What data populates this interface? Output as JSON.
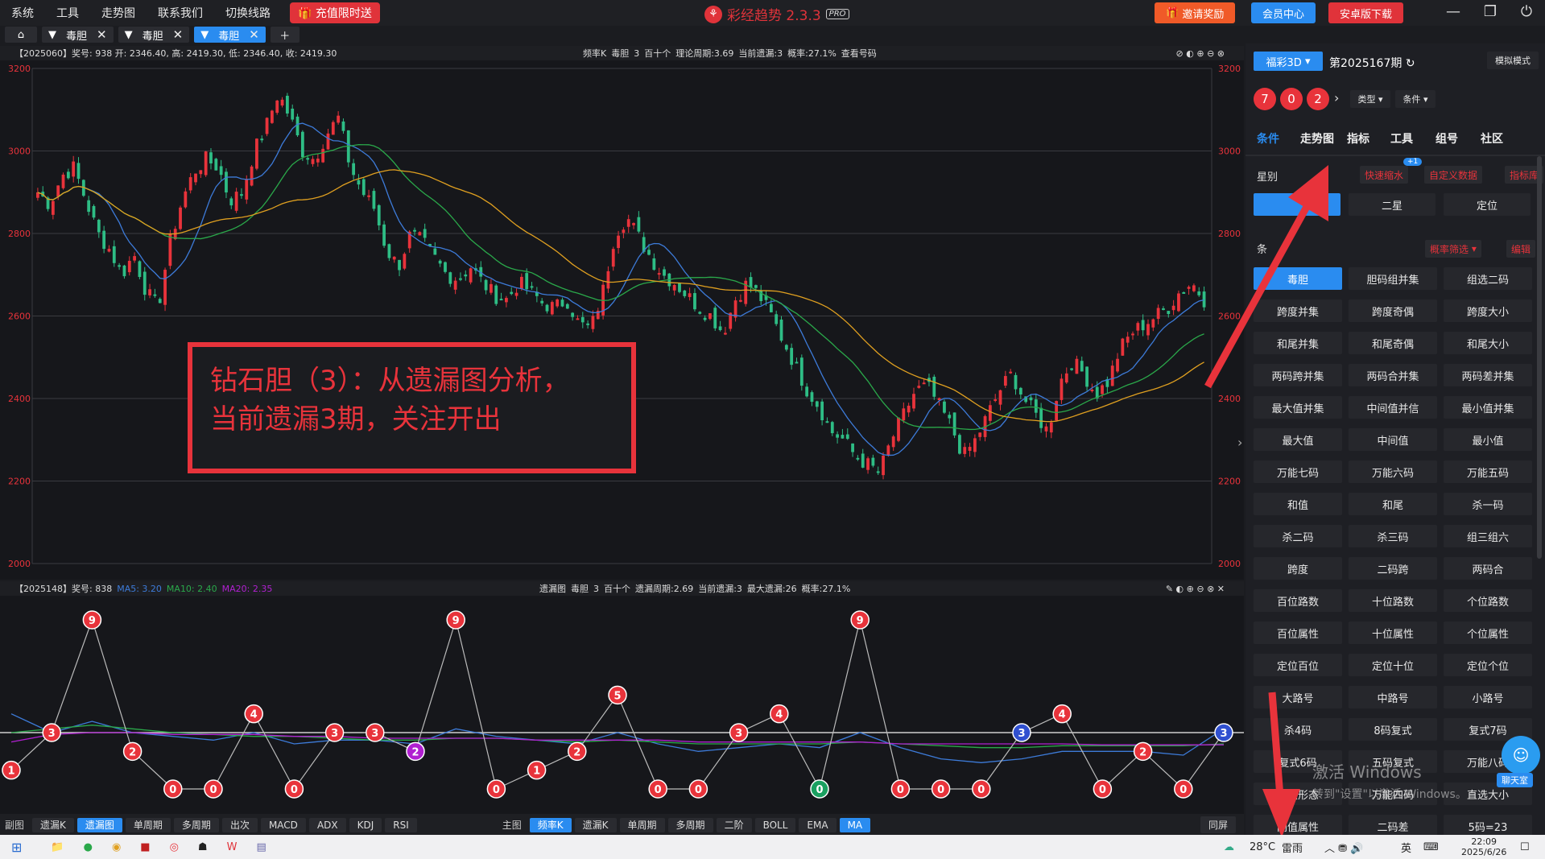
{
  "menu": [
    "系统",
    "工具",
    "走势图",
    "联系我们",
    "切换线路"
  ],
  "promo": "充值限时送",
  "app_title": "彩经趋势 2.3.3",
  "app_badge": "PRO",
  "top_buttons": {
    "invite": "邀请奖励",
    "member": "会员中心",
    "android": "安卓版下载"
  },
  "tabs": [
    "毒胆",
    "毒胆",
    "毒胆"
  ],
  "top_info": {
    "left": "【2025060】奖号: 938  开: 2346.40, 高: 2419.30, 低: 2346.40, 收: 2419.30",
    "right": [
      "频率K",
      "毒胆",
      "3",
      "百十个",
      "理论周期:3.69",
      "当前遗漏:3",
      "概率:27.1%",
      "查看号码"
    ]
  },
  "bottom_info": {
    "period": "【2025148】奖号: 838",
    "ma5": "MA5: 3.20",
    "ma10": "MA10: 2.40",
    "ma20": "MA20: 2.35",
    "right": [
      "遗漏图",
      "毒胆",
      "3",
      "百十个",
      "遗漏周期:2.69",
      "当前遗漏:3",
      "最大遗漏:26",
      "概率:27.1%"
    ]
  },
  "y_labels": [
    "3200",
    "3000",
    "2800",
    "2600",
    "2400",
    "2200",
    "2000"
  ],
  "colors": {
    "up": "#e8333b",
    "down": "#2ebd85",
    "ma5": "#3d7bd9",
    "ma10": "#2aa84a",
    "ma20": "#e0a020",
    "accent": "#2a8cf0",
    "red": "#e8333b",
    "purple": "#b020d0",
    "blue": "#3050d0",
    "green": "#1aa060"
  },
  "chart_data": [
    {
      "type": "candlestick",
      "title": "",
      "description": "频率K candlestick",
      "ylim": [
        2000,
        3200
      ],
      "close_trend": [
        2900,
        2870,
        2940,
        2960,
        2880,
        2800,
        2760,
        2700,
        2750,
        2660,
        2620,
        2780,
        2880,
        2950,
        2980,
        2960,
        2880,
        2900,
        3000,
        3060,
        3140,
        3080,
        3000,
        2980,
        3040,
        3080,
        2960,
        2900,
        2860,
        2760,
        2720,
        2800,
        2780,
        2740,
        2700,
        2690,
        2720,
        2680,
        2650,
        2640,
        2680,
        2660,
        2630,
        2620,
        2640,
        2580,
        2570,
        2660,
        2800,
        2840,
        2790,
        2740,
        2700,
        2680,
        2650,
        2620,
        2600,
        2560,
        2640,
        2680,
        2650,
        2600,
        2540,
        2480,
        2420,
        2380,
        2320,
        2300,
        2260,
        2240,
        2220,
        2300,
        2360,
        2420,
        2430,
        2380,
        2330,
        2260,
        2300,
        2360,
        2420,
        2460,
        2400,
        2360,
        2320,
        2440,
        2490,
        2460,
        2410,
        2440,
        2520,
        2560,
        2580,
        2600,
        2620,
        2660,
        2680,
        2640
      ]
    },
    {
      "type": "line",
      "title": "",
      "description": "遗漏图 omission values",
      "values": [
        1,
        3,
        9,
        2,
        0,
        0,
        4,
        0,
        3,
        3,
        2,
        9,
        0,
        1,
        2,
        5,
        0,
        0,
        3,
        4,
        0,
        9,
        0,
        0,
        0,
        3,
        4,
        0,
        2,
        0,
        3
      ],
      "ma5": [
        4,
        3,
        3.6,
        3,
        2.8,
        2.6,
        3,
        2.4,
        2.6,
        2.6,
        2.4,
        3.2,
        2.8,
        2.6,
        2.4,
        3,
        2.4,
        2,
        2.2,
        2.4,
        2.2,
        3,
        2.2,
        1.6,
        1.4,
        1.6,
        2,
        2,
        2,
        1.8,
        3.2
      ],
      "ma10": [
        3,
        3.2,
        3.4,
        3.2,
        3,
        2.9,
        2.8,
        2.8,
        2.7,
        2.6,
        2.6,
        2.7,
        2.7,
        2.6,
        2.5,
        2.6,
        2.5,
        2.4,
        2.4,
        2.4,
        2.4,
        2.5,
        2.4,
        2.3,
        2.2,
        2.2,
        2.3,
        2.3,
        2.3,
        2.3,
        2.4
      ],
      "ma20": [
        2.5,
        2.9,
        3,
        3,
        2.9,
        2.9,
        2.9,
        2.8,
        2.8,
        2.7,
        2.7,
        2.7,
        2.7,
        2.6,
        2.6,
        2.6,
        2.6,
        2.5,
        2.5,
        2.5,
        2.5,
        2.5,
        2.4,
        2.4,
        2.4,
        2.4,
        2.4,
        2.35,
        2.35,
        2.35,
        2.35
      ]
    }
  ],
  "annotation": [
    "钻石胆（3）：从遗漏图分析，",
    "当前遗漏3期，关注开出"
  ],
  "right": {
    "lottery": "福彩3D",
    "period": "第2025167期",
    "mode": "模拟模式",
    "balls": [
      "7",
      "0",
      "2"
    ],
    "type": "类型",
    "cond": "条件",
    "navtabs": [
      "条件",
      "走势图",
      "指标",
      "工具",
      "组号",
      "社区"
    ],
    "star_label": "星别",
    "quick": "快速缩水",
    "badge": "+1",
    "custom": "自定义数据",
    "indicator": "指标库",
    "star_buttons": [
      "",
      "二星",
      "定位"
    ],
    "cond_label": "条",
    "prob_filter": "概率筛选",
    "edit": "编辑",
    "grid": [
      "毒胆",
      "胆码组并集",
      "组选二码",
      "跨度并集",
      "跨度奇偶",
      "跨度大小",
      "和尾并集",
      "和尾奇偶",
      "和尾大小",
      "两码跨并集",
      "两码合并集",
      "两码差并集",
      "最大值并集",
      "中间值并信",
      "最小值并集",
      "最大值",
      "中间值",
      "最小值",
      "万能七码",
      "万能六码",
      "万能五码",
      "和值",
      "和尾",
      "杀一码",
      "杀二码",
      "杀三码",
      "组三组六",
      "跨度",
      "二码跨",
      "两码合",
      "百位路数",
      "十位路数",
      "个位路数",
      "百位属性",
      "十位属性",
      "个位属性",
      "定位百位",
      "定位十位",
      "定位个位",
      "大路号",
      "中路号",
      "小路号",
      "杀4码",
      "8码复式",
      "复式7码",
      "复式6码",
      "五码复式",
      "万能八码",
      "组六形态",
      "万能四码",
      "直选大小",
      "间值属性",
      "二码差",
      "5码=23"
    ],
    "chat": "聊天室"
  },
  "watermark": {
    "line1": "激活 Windows",
    "line2": "转到\"设置\"以激活 Windows。"
  },
  "bottom_toolbar": {
    "sub_label": "副图",
    "sub": [
      "遗漏K",
      "遗漏图",
      "单周期",
      "多周期",
      "出次",
      "MACD",
      "ADX",
      "KDJ",
      "RSI"
    ],
    "main_label": "主图",
    "main": [
      "频率K",
      "遗漏K",
      "单周期",
      "多周期",
      "二阶",
      "BOLL",
      "EMA",
      "MA"
    ],
    "same": "同屏"
  },
  "taskbar": {
    "weather": "28°C",
    "weather_desc": "雷雨",
    "ime": "英",
    "time": "22:09",
    "date": "2025/6/26"
  }
}
